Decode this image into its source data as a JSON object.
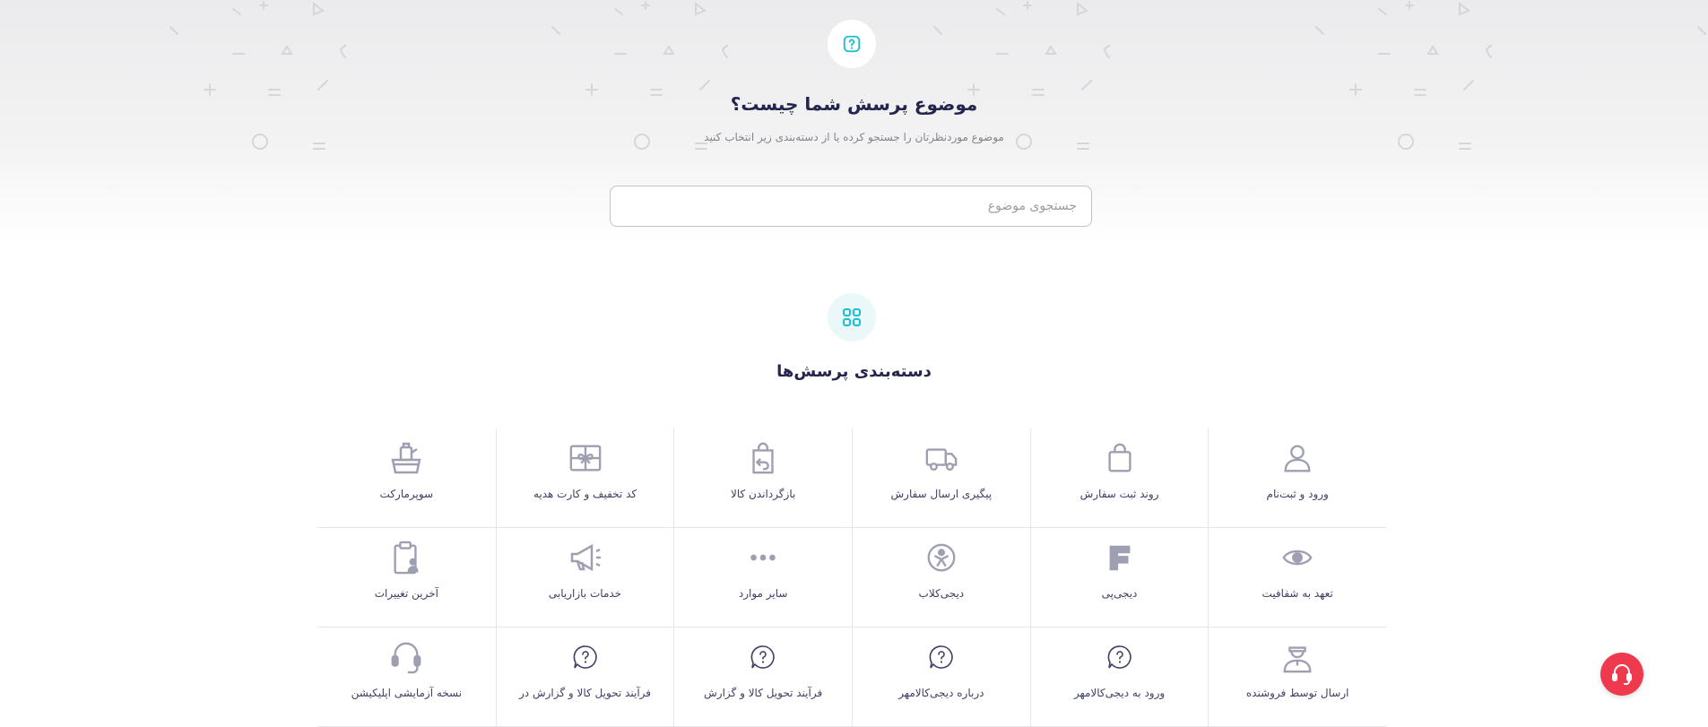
{
  "hero": {
    "title": "موضوع پرسش شما چیست؟",
    "subtitle": "موضوع موردنظرتان را جستجو کرده یا از دسته‌بندی زیر انتخاب کنید",
    "icon": "question-icon"
  },
  "search": {
    "placeholder": "جستجوی موضوع",
    "value": ""
  },
  "categories_section": {
    "title": "دسته‌بندی پرسش‌ها",
    "icon": "categories-icon"
  },
  "categories": [
    {
      "label": "ورود و ثبت‌نام",
      "icon": "user-icon"
    },
    {
      "label": "روند ثبت سفارش",
      "icon": "shopping-bag-icon"
    },
    {
      "label": "پیگیری ارسال سفارش",
      "icon": "truck-icon"
    },
    {
      "label": "بازگرداندن کالا",
      "icon": "return-bag-icon"
    },
    {
      "label": "کد تخفیف و کارت هدیه",
      "icon": "gift-card-icon"
    },
    {
      "label": "سوپرمارکت",
      "icon": "grocery-basket-icon"
    },
    {
      "label": "تعهد به شفافیت",
      "icon": "eye-icon"
    },
    {
      "label": "دیجی‌پی",
      "icon": "digipay-icon"
    },
    {
      "label": "دیجی‌کلاب",
      "icon": "digiclub-icon"
    },
    {
      "label": "سایر موارد",
      "icon": "more-dots-icon"
    },
    {
      "label": "خدمات بازاریابی",
      "icon": "megaphone-icon"
    },
    {
      "label": "آخرین تغییرات",
      "icon": "clipboard-icon"
    },
    {
      "label": "ارسال توسط فروشنده",
      "icon": "seller-courier-icon"
    },
    {
      "label": "ورود به دیجی‌کالامهر",
      "icon": "question-bubble-icon"
    },
    {
      "label": "درباره دیجی‌کالامهر",
      "icon": "question-bubble-icon"
    },
    {
      "label": "فرآیند تحویل کالا و گزارش",
      "icon": "question-bubble-icon"
    },
    {
      "label": "فرآیند تحویل کالا و گزارش در",
      "icon": "question-bubble-icon"
    },
    {
      "label": "نسخه آزمایشی اپلیکیشن",
      "icon": "headset-icon"
    }
  ],
  "support_button": {
    "icon": "headset-icon"
  },
  "colors": {
    "accent": "#19bfd3",
    "icon_gray": "#9e9fb1",
    "text_dark": "#23254e",
    "support_red": "#ef394e"
  }
}
